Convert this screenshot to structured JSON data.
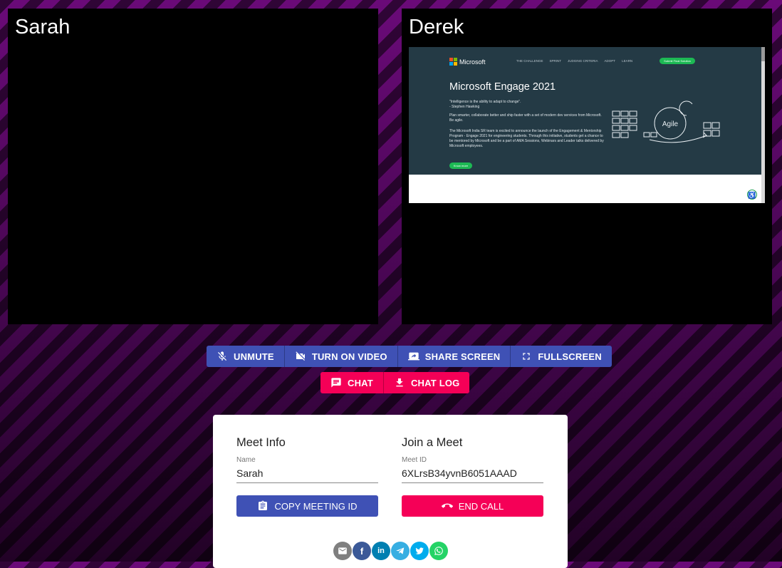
{
  "participants": {
    "local": {
      "name": "Sarah"
    },
    "remote": {
      "name": "Derek"
    }
  },
  "shared_screen": {
    "brand": "Microsoft",
    "nav": [
      "THE CHALLENGE",
      "SPRINT",
      "JUDGING CRITERIA",
      "ADOPT",
      "LEARN"
    ],
    "submit_button": "Submit Final Solution",
    "title": "Microsoft Engage 2021",
    "quote": "\"Intelligence is the ability to adapt to change\".",
    "quote_author": "- Stephen Hawking",
    "tagline": "Plan smarter, collaborate better and ship faster with a set of modern dev services from Microsoft. Be agile.",
    "description": "The Microsoft India SR team is excited to announce the launch of the Engagement & Mentorship Program - Engage 2021 for engineering students. Through this initiative, students get a chance to be mentored by Microsoft and be a part of AMA Sessions, Webinars and Leader talks delivered by Microsoft employees.",
    "know_more": "Know more",
    "agile_label": "Agile"
  },
  "controls": {
    "unmute": "UNMUTE",
    "turn_on_video": "TURN ON VIDEO",
    "share_screen": "SHARE SCREEN",
    "fullscreen": "FULLSCREEN",
    "chat": "CHAT",
    "chat_log": "CHAT LOG"
  },
  "meet_info": {
    "title": "Meet Info",
    "name_label": "Name",
    "name_value": "Sarah",
    "copy_button": "COPY MEETING ID"
  },
  "join_meet": {
    "title": "Join a Meet",
    "id_label": "Meet ID",
    "id_value": "6XLrsB34yvnB6051AAAD",
    "end_button": "END CALL"
  },
  "share_buttons": [
    {
      "icon": "email-icon",
      "color": "#7f7f7f"
    },
    {
      "icon": "facebook-icon",
      "color": "#3b5998"
    },
    {
      "icon": "linkedin-icon",
      "color": "#007fb1"
    },
    {
      "icon": "telegram-icon",
      "color": "#37aee2"
    },
    {
      "icon": "twitter-icon",
      "color": "#00aced"
    },
    {
      "icon": "whatsapp-icon",
      "color": "#25d366"
    }
  ],
  "colors": {
    "primary": "#3f51b5",
    "secondary": "#f50057",
    "microsoft_green": "#1db954"
  }
}
